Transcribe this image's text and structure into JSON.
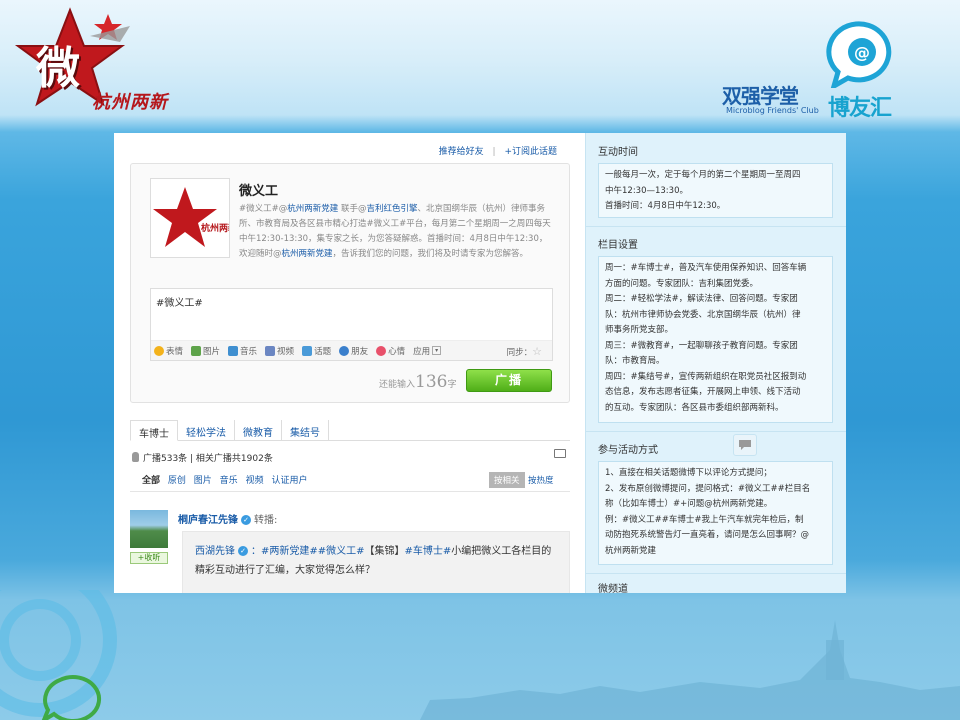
{
  "header": {
    "logo_char": "微",
    "logo_title": "杭州两新",
    "club_cn_a": "双强学堂",
    "club_cn_b": "博友汇",
    "club_en": "Microblog Friends' Club"
  },
  "top_links": {
    "recommend": "推荐给好友",
    "separator": "|",
    "subscribe": "+订阅此话题"
  },
  "topic": {
    "title": "微义工",
    "desc_a": "#微义工#@",
    "desc_lk1": "杭州两新党建",
    "desc_b": " 联手@",
    "desc_lk2": "吉利红色引擎",
    "desc_c": "、北京国纲华辰（杭州）律师事务所、市教育局及各区县市精心打造#微义工#平台，每月第二个星期周一之周四每天中午12:30-13:30，集专家之长，为您答疑解惑。首播时间：4月8日中午12:30，欢迎随时@",
    "desc_lk3": "杭州两新党建",
    "desc_d": "，告诉我们您的问题，我们将及时请专家为您解答。"
  },
  "composer": {
    "text": "#微义工#",
    "tools": [
      "表情",
      "图片",
      "音乐",
      "视频",
      "话题",
      "朋友",
      "心情",
      "应用"
    ],
    "sync_label": "同步：",
    "counter_prefix": "还能输入",
    "counter_value": "136",
    "counter_suffix": "字",
    "send_label": "广播"
  },
  "tabs": [
    "车博士",
    "轻松学法",
    "微教育",
    "集结号"
  ],
  "stats": {
    "text": "广播533条 | 相关广播共1902条"
  },
  "filters": {
    "items": [
      "全部",
      "原创",
      "图片",
      "音乐",
      "视频",
      "认证用户"
    ],
    "sort_related": "按相关",
    "sort_hot": "按热度"
  },
  "feed": {
    "author": "桐庐春江先锋",
    "verified_mark": "✓",
    "action": "转播:",
    "follow_label": "+收听",
    "quote_author": "西湖先锋",
    "quote_tags": "：#两新党建##微义工#",
    "quote_text_a": "【集锦】",
    "quote_tag2": "#车博士#",
    "quote_text_b": "小编把微义工各栏目的精彩互动进行了汇编，大家觉得怎么样？"
  },
  "right": {
    "interaction_title": "互动时间",
    "interaction_lines": [
      "一般每月一次，定于每个月的第二个星期周一至周四",
      "中午12:30—13:30。",
      "首播时间：4月8日中午12:30。"
    ],
    "column_title": "栏目设置",
    "column_lines": [
      "周一：#车博士#，普及汽车使用保养知识、回答车辆",
      "方面的问题。专家团队：吉利集团党委。",
      "周二：#轻松学法#，解读法律、回答问题。专家团",
      "队：杭州市律师协会党委、北京国纲华辰（杭州）律",
      "师事务所党支部。",
      "周三：#微教育#，一起聊聊孩子教育问题。专家团",
      "队：市教育局。",
      "周四：#集结号#，宣传两新组织在职党员社区报到动",
      "态信息，发布志愿者征集，开展网上申领、线下活动",
      "的互动。专家团队：各区县市委组织部两新科。"
    ],
    "join_title": "参与活动方式",
    "join_lines": [
      "1、直接在相关话题微博下以评论方式提问；",
      "2、发布原创微博提问，提问格式：#微义工##栏目名",
      "称（比如车博士）#+问题@杭州两新党建。",
      "例：#微义工##车博士#我上午汽车就完年检后，制",
      "动防抱死系统警告灯一直亮着，请问是怎么回事啊？@",
      "杭州两新党建"
    ],
    "micro_title": "微频道"
  },
  "colors": {
    "link": "#1a5ca8",
    "send_button": "#5cb91f",
    "logo_red": "#c0181d",
    "club_blue": "#1d5fa8"
  },
  "icons": [
    "emoji-icon",
    "image-icon",
    "music-icon",
    "video-icon",
    "topic-icon",
    "friend-icon",
    "heart-icon",
    "app-icon",
    "star-icon",
    "mic-icon",
    "screen-icon",
    "chat-icon"
  ]
}
